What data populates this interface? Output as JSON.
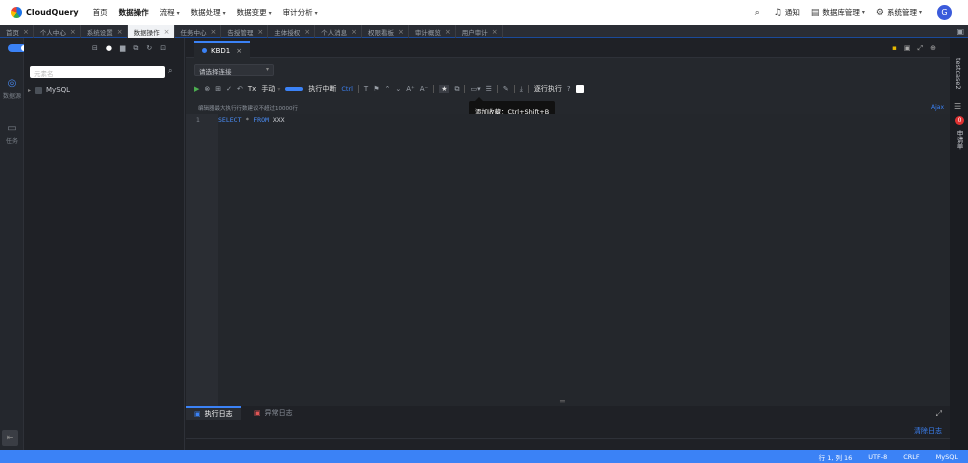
{
  "brand": {
    "name": "CloudQuery"
  },
  "topnav": {
    "items": [
      {
        "label": "首页",
        "dropdown": false
      },
      {
        "label": "数据操作",
        "dropdown": false,
        "active": true
      },
      {
        "label": "流程",
        "dropdown": true
      },
      {
        "label": "数据处理",
        "dropdown": true
      },
      {
        "label": "数据变更",
        "dropdown": true
      },
      {
        "label": "审计分析",
        "dropdown": true
      }
    ],
    "right": {
      "notice": "通知",
      "db_manage": "数据库管理",
      "sys_manage": "系统管理",
      "avatar": "G"
    }
  },
  "page_tabs": [
    "首页",
    "个人中心",
    "系统设置",
    "数据操作",
    "任务中心",
    "告授管理",
    "主体授权",
    "个人消息",
    "权限看板",
    "审计概览",
    "用户审计"
  ],
  "active_page_tab": "数据操作",
  "leftrail": {
    "item1": "数据源",
    "item2": "任务"
  },
  "tree": {
    "search_placeholder": "元素名",
    "root": "MySQL"
  },
  "editor": {
    "tab": "KBD1",
    "connection_placeholder": "请选择连接",
    "toolbar": {
      "tx": "Tx",
      "mode": "手动",
      "interrupt": "执行中断",
      "ctrl_label": "Ctrl",
      "line_exec": "逐行执行"
    },
    "tooltip": {
      "label": "添加收藏：",
      "shortcut": "Ctrl+Shift+B"
    },
    "hint": "编辑器最大执行行数建议不超过10000行",
    "hint_right": "Ajax",
    "line_no": "1",
    "code": {
      "kw1": "SELECT",
      "op": "*",
      "kw2": "FROM",
      "table": "XXX"
    }
  },
  "bottom": {
    "tab_exec_log": "执行日志",
    "tab_err_log": "异常日志",
    "clear": "清除日志"
  },
  "rightrail": {
    "conn": "testcase2",
    "badge": "0",
    "apply": "申请单"
  },
  "statusbar": {
    "position": "行 1, 列 16",
    "encoding": "UTF-8",
    "eol": "CRLF",
    "db": "MySQL"
  },
  "colors": {
    "accent": "#3b82f6",
    "danger": "#e03131",
    "success": "#4caf50"
  }
}
